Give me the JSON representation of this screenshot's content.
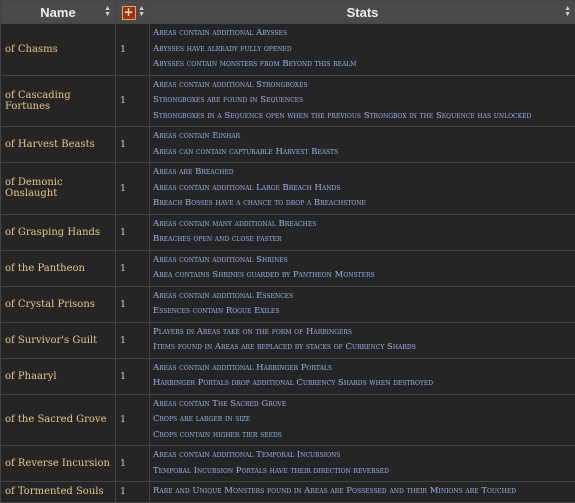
{
  "header": {
    "name_label": "Name",
    "level_symbol": "+",
    "stats_label": "Stats"
  },
  "rows": [
    {
      "name": "of Chasms",
      "level": "1",
      "stats": [
        "Areas contain additional Abysses",
        "Abysses have already fully opened",
        "Abysses contain monsters from Beyond this realm"
      ]
    },
    {
      "name": "of Cascading Fortunes",
      "level": "1",
      "stats": [
        "Areas contain additional Strongboxes",
        "Strongboxes are found in Sequences",
        "Strongboxes in a Sequence open when the previous Strongbox in the Sequence has unlocked"
      ]
    },
    {
      "name": "of Harvest Beasts",
      "level": "1",
      "stats": [
        "Areas contain Einhar",
        "Areas can contain capturable Harvest Beasts"
      ]
    },
    {
      "name": "of Demonic Onslaught",
      "level": "1",
      "stats": [
        "Areas are Breached",
        "Areas contain additional Large Breach Hands",
        "Breach Bosses have a chance to drop a Breachstone"
      ]
    },
    {
      "name": "of Grasping Hands",
      "level": "1",
      "stats": [
        "Areas contain many additional Breaches",
        "Breaches open and close faster"
      ]
    },
    {
      "name": "of the Pantheon",
      "level": "1",
      "stats": [
        "Areas contain additional Shrines",
        "Area contains Shrines guarded by Pantheon Monsters"
      ]
    },
    {
      "name": "of Crystal Prisons",
      "level": "1",
      "stats": [
        "Areas contain additional Essences",
        "Essences contain Rogue Exiles"
      ]
    },
    {
      "name": "of Survivor's Guilt",
      "level": "1",
      "stats": [
        "Players in Areas take on the form of Harbingers",
        "Items found in Areas are replaced by stacks of Currency Shards"
      ]
    },
    {
      "name": "of Phaaryl",
      "level": "1",
      "stats": [
        "Areas contain additional Harbinger Portals",
        "Harbinger Portals drop additional Currency Shards when destroyed"
      ]
    },
    {
      "name": "of the Sacred Grove",
      "level": "1",
      "stats": [
        "Areas contain The Sacred Grove",
        "Crops are larger in size",
        "Crops contain higher tier seeds"
      ]
    },
    {
      "name": "of Reverse Incursion",
      "level": "1",
      "stats": [
        "Areas contain additional Temporal Incursions",
        "Temporal Incursion Portals have their direction reversed"
      ]
    },
    {
      "name": "of Tormented Souls",
      "level": "1",
      "stats": [
        "Rare and Unique Monsters found in Areas are Possessed and their Minions are Touched"
      ]
    }
  ]
}
